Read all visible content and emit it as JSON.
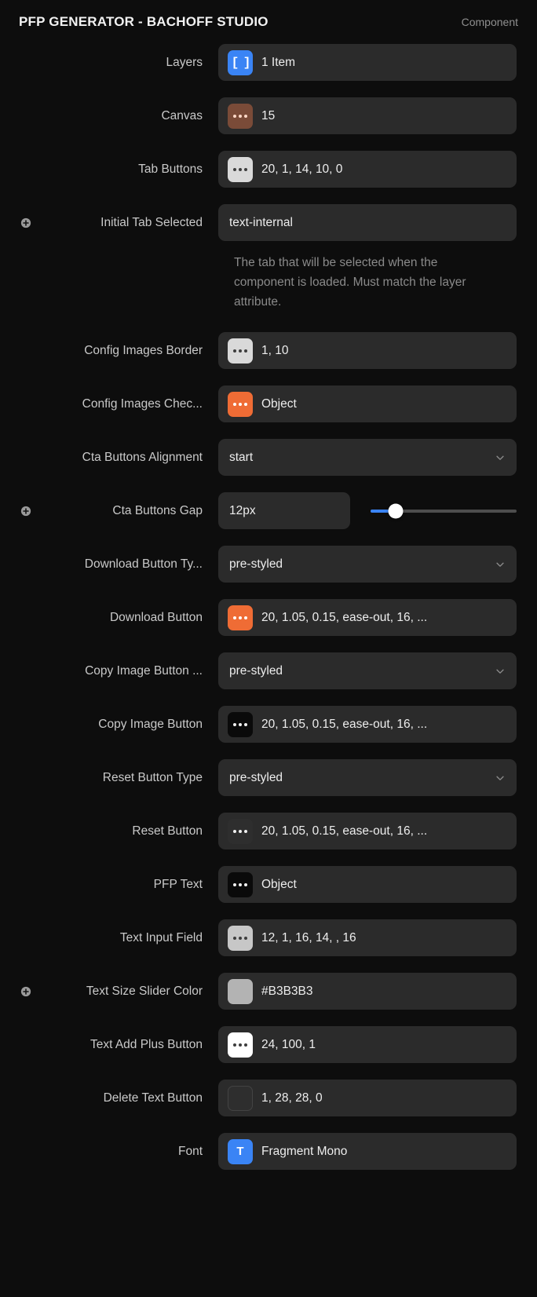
{
  "header": {
    "title": "PFP GENERATOR - BACHOFF STUDIO",
    "badge": "Component"
  },
  "rows": [
    {
      "label": "Layers",
      "value": "1 Item",
      "chip": "bracket-blue",
      "kind": "chip"
    },
    {
      "label": "Canvas",
      "value": "15",
      "chip": "dots-brown",
      "kind": "chip"
    },
    {
      "label": "Tab Buttons",
      "value": "20, 1, 14, 10, 0",
      "chip": "dots-light",
      "kind": "chip"
    },
    {
      "label": "Initial Tab Selected",
      "value": "text-internal",
      "chip": "none",
      "kind": "plain",
      "expandable": true,
      "helper": "The tab that will be selected when the component is loaded. Must match the layer attribute."
    },
    {
      "label": "Config Images Border",
      "value": "1, 10",
      "chip": "dots-light",
      "kind": "chip"
    },
    {
      "label": "Config Images Chec...",
      "value": "Object",
      "chip": "dots-orange",
      "kind": "chip"
    },
    {
      "label": "Cta Buttons Alignment",
      "value": "start",
      "chip": "none",
      "kind": "select"
    },
    {
      "label": "Cta Buttons Gap",
      "value": "12px",
      "chip": "none",
      "kind": "slider",
      "expandable": true,
      "slider": {
        "percent": 17
      }
    },
    {
      "label": "Download Button Ty...",
      "value": "pre-styled",
      "chip": "none",
      "kind": "select"
    },
    {
      "label": "Download Button",
      "value": "20, 1.05, 0.15, ease-out, 16, ...",
      "chip": "dots-orange",
      "kind": "chip"
    },
    {
      "label": "Copy Image Button ...",
      "value": "pre-styled",
      "chip": "none",
      "kind": "select"
    },
    {
      "label": "Copy Image Button",
      "value": "20, 1.05, 0.15, ease-out, 16, ...",
      "chip": "dots-black",
      "kind": "chip"
    },
    {
      "label": "Reset Button Type",
      "value": "pre-styled",
      "chip": "none",
      "kind": "select"
    },
    {
      "label": "Reset Button",
      "value": "20, 1.05, 0.15, ease-out, 16, ...",
      "chip": "dots-darkgray",
      "kind": "chip"
    },
    {
      "label": "PFP Text",
      "value": "Object",
      "chip": "dots-black",
      "kind": "chip"
    },
    {
      "label": "Text Input Field",
      "value": "12, 1, 16, 14, , 16",
      "chip": "dots-lightgray",
      "kind": "chip"
    },
    {
      "label": "Text Size Slider Color",
      "value": "#B3B3B3",
      "chip": "solid-b3b3b3",
      "kind": "chip",
      "expandable": true
    },
    {
      "label": "Text Add Plus Button",
      "value": "24, 100, 1",
      "chip": "dots-white",
      "kind": "chip"
    },
    {
      "label": "Delete Text Button",
      "value": "1, 28, 28, 0",
      "chip": "solid-darkgray",
      "kind": "chip"
    },
    {
      "label": "Font",
      "value": "Fragment Mono",
      "chip": "letter-t-blue",
      "kind": "chip"
    }
  ],
  "colors": {
    "background": "#0D0D0D",
    "field_background": "#2B2B2B",
    "accent_blue": "#3A84F5",
    "accent_orange": "#EF6C35",
    "chip_brown": "#7A4B38",
    "chip_light": "#D9D9D9",
    "chip_lightgray": "#C7C7C7",
    "chip_black": "#0A0A0A",
    "chip_darkgray": "#2E2E2E",
    "chip_white": "#FFFFFF",
    "swatch_b3b3b3": "#B3B3B3",
    "text_primary": "#EDEDED",
    "text_label": "#C9C9C9",
    "text_muted": "#8A8A8A"
  },
  "icons": {
    "plus_circle": "plus-circle-icon",
    "chevron_down": "chevron-down-icon"
  }
}
